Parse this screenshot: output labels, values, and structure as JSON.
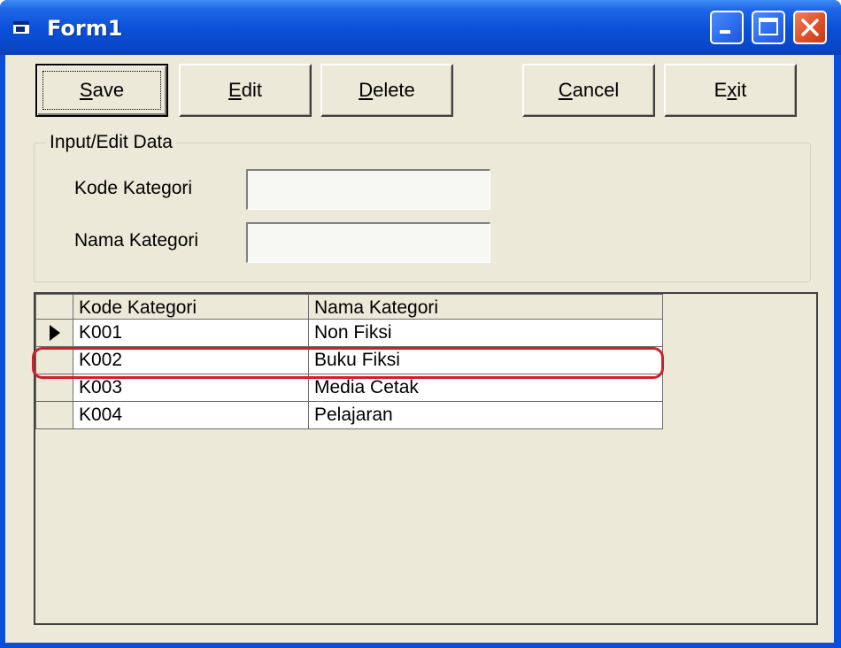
{
  "window": {
    "title": "Form1",
    "title_icon": "form-icon",
    "controls": [
      "minimize-icon",
      "maximize-icon",
      "close-icon"
    ],
    "accent_color": "#0a4fd8"
  },
  "toolbar": {
    "save": {
      "prefix": "",
      "mnemonic": "S",
      "suffix": "ave"
    },
    "edit": {
      "prefix": "",
      "mnemonic": "E",
      "suffix": "dit"
    },
    "delete": {
      "prefix": "",
      "mnemonic": "D",
      "suffix": "elete"
    },
    "cancel": {
      "prefix": "",
      "mnemonic": "C",
      "suffix": "ancel"
    },
    "exit": {
      "prefix": "E",
      "mnemonic": "x",
      "suffix": "it"
    }
  },
  "input_group": {
    "label": "Input/Edit Data",
    "kode_label": "Kode Kategori",
    "kode_value": "",
    "nama_label": "Nama Kategori",
    "nama_value": ""
  },
  "grid": {
    "columns": [
      "Kode Kategori",
      "Nama Kategori"
    ],
    "rows": [
      {
        "kode": "K001",
        "nama": "Non Fiksi",
        "current": true
      },
      {
        "kode": "K002",
        "nama": "Buku Fiksi",
        "current": false
      },
      {
        "kode": "K003",
        "nama": "Media Cetak",
        "current": false
      },
      {
        "kode": "K004",
        "nama": "Pelajaran",
        "current": false
      }
    ],
    "highlight_color": "#d01e2b"
  }
}
